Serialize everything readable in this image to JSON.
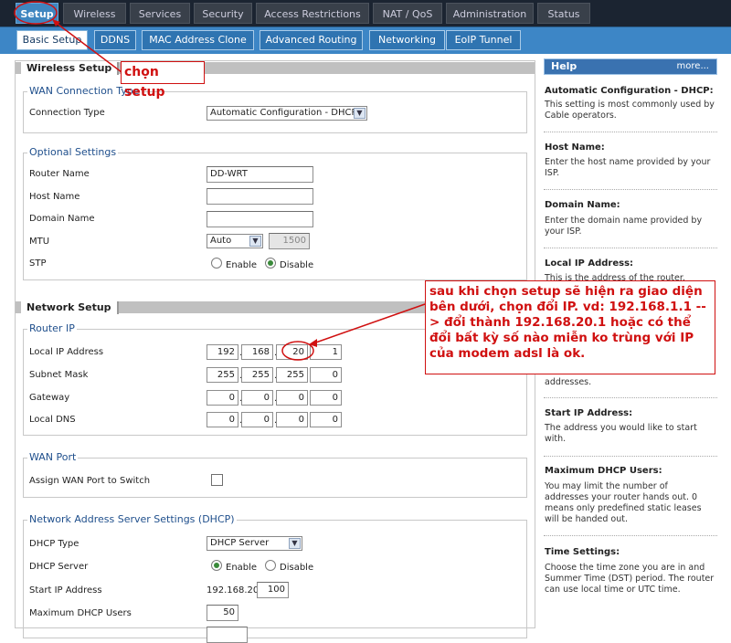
{
  "top_tabs": [
    "Setup",
    "Wireless",
    "Services",
    "Security",
    "Access Restrictions",
    "NAT / QoS",
    "Administration",
    "Status"
  ],
  "sub_tabs": [
    "Basic Setup",
    "DDNS",
    "MAC Address Clone",
    "Advanced Routing",
    "Networking",
    "EoIP Tunnel"
  ],
  "sections": {
    "wireless_setup": "Wireless Setup",
    "network_setup": "Network Setup"
  },
  "wan": {
    "legend": "WAN Connection Type",
    "conn_type_label": "Connection Type",
    "conn_type_value": "Automatic Configuration - DHCP"
  },
  "optional": {
    "legend": "Optional Settings",
    "router_name_label": "Router Name",
    "router_name_value": "DD-WRT",
    "host_name_label": "Host Name",
    "host_name_value": "",
    "domain_name_label": "Domain Name",
    "domain_name_value": "",
    "mtu_label": "MTU",
    "mtu_mode": "Auto",
    "mtu_value": "1500",
    "stp_label": "STP",
    "stp_enable": "Enable",
    "stp_disable": "Disable"
  },
  "router_ip": {
    "legend": "Router IP",
    "local_ip_label": "Local IP Address",
    "local_ip": [
      "192",
      "168",
      "20",
      "1"
    ],
    "subnet_label": "Subnet Mask",
    "subnet": [
      "255",
      "255",
      "255",
      "0"
    ],
    "gateway_label": "Gateway",
    "gateway": [
      "0",
      "0",
      "0",
      "0"
    ],
    "dns_label": "Local DNS",
    "dns": [
      "0",
      "0",
      "0",
      "0"
    ]
  },
  "wan_port": {
    "legend": "WAN Port",
    "assign_label": "Assign WAN Port to Switch"
  },
  "dhcp": {
    "legend": "Network Address Server Settings (DHCP)",
    "type_label": "DHCP Type",
    "type_value": "DHCP Server",
    "server_label": "DHCP Server",
    "server_enable": "Enable",
    "server_disable": "Disable",
    "start_label": "Start IP Address",
    "start_prefix": "192.168.20.",
    "start_value": "100",
    "max_label": "Maximum DHCP Users",
    "max_value": "50"
  },
  "help": {
    "title": "Help",
    "more": "more...",
    "items": [
      {
        "title": "Automatic Configuration - DHCP:",
        "text": "This setting is most commonly used by Cable operators."
      },
      {
        "title": "Host Name:",
        "text": "Enter the host name provided by your ISP."
      },
      {
        "title": "Domain Name:",
        "text": "Enter the domain name provided by your ISP."
      },
      {
        "title": "Local IP Address:",
        "text": "This is the address of the router."
      },
      {
        "title": "",
        "text": "addresses."
      },
      {
        "title": "Start IP Address:",
        "text": "The address you would like to start with."
      },
      {
        "title": "Maximum DHCP Users:",
        "text": "You may limit the number of addresses your router hands out. 0 means only predefined static leases will be handed out."
      },
      {
        "title": "Time Settings:",
        "text": "Choose the time zone you are in and Summer Time (DST) period. The router can use local time or UTC time."
      }
    ]
  },
  "annotations": {
    "setup_note": "chọn setup",
    "ip_note": "sau khi chọn setup sẽ hiện ra giao diện bên dưới, chọn đổi IP. vd: 192.168.1.1 --> đổi thành 192.168.20.1 hoặc có thể đổi bất kỳ số nào miễn ko trùng với IP của modem adsl là ok."
  },
  "colors": {
    "annotation": "#d01010",
    "accent": "#3d86c6"
  }
}
